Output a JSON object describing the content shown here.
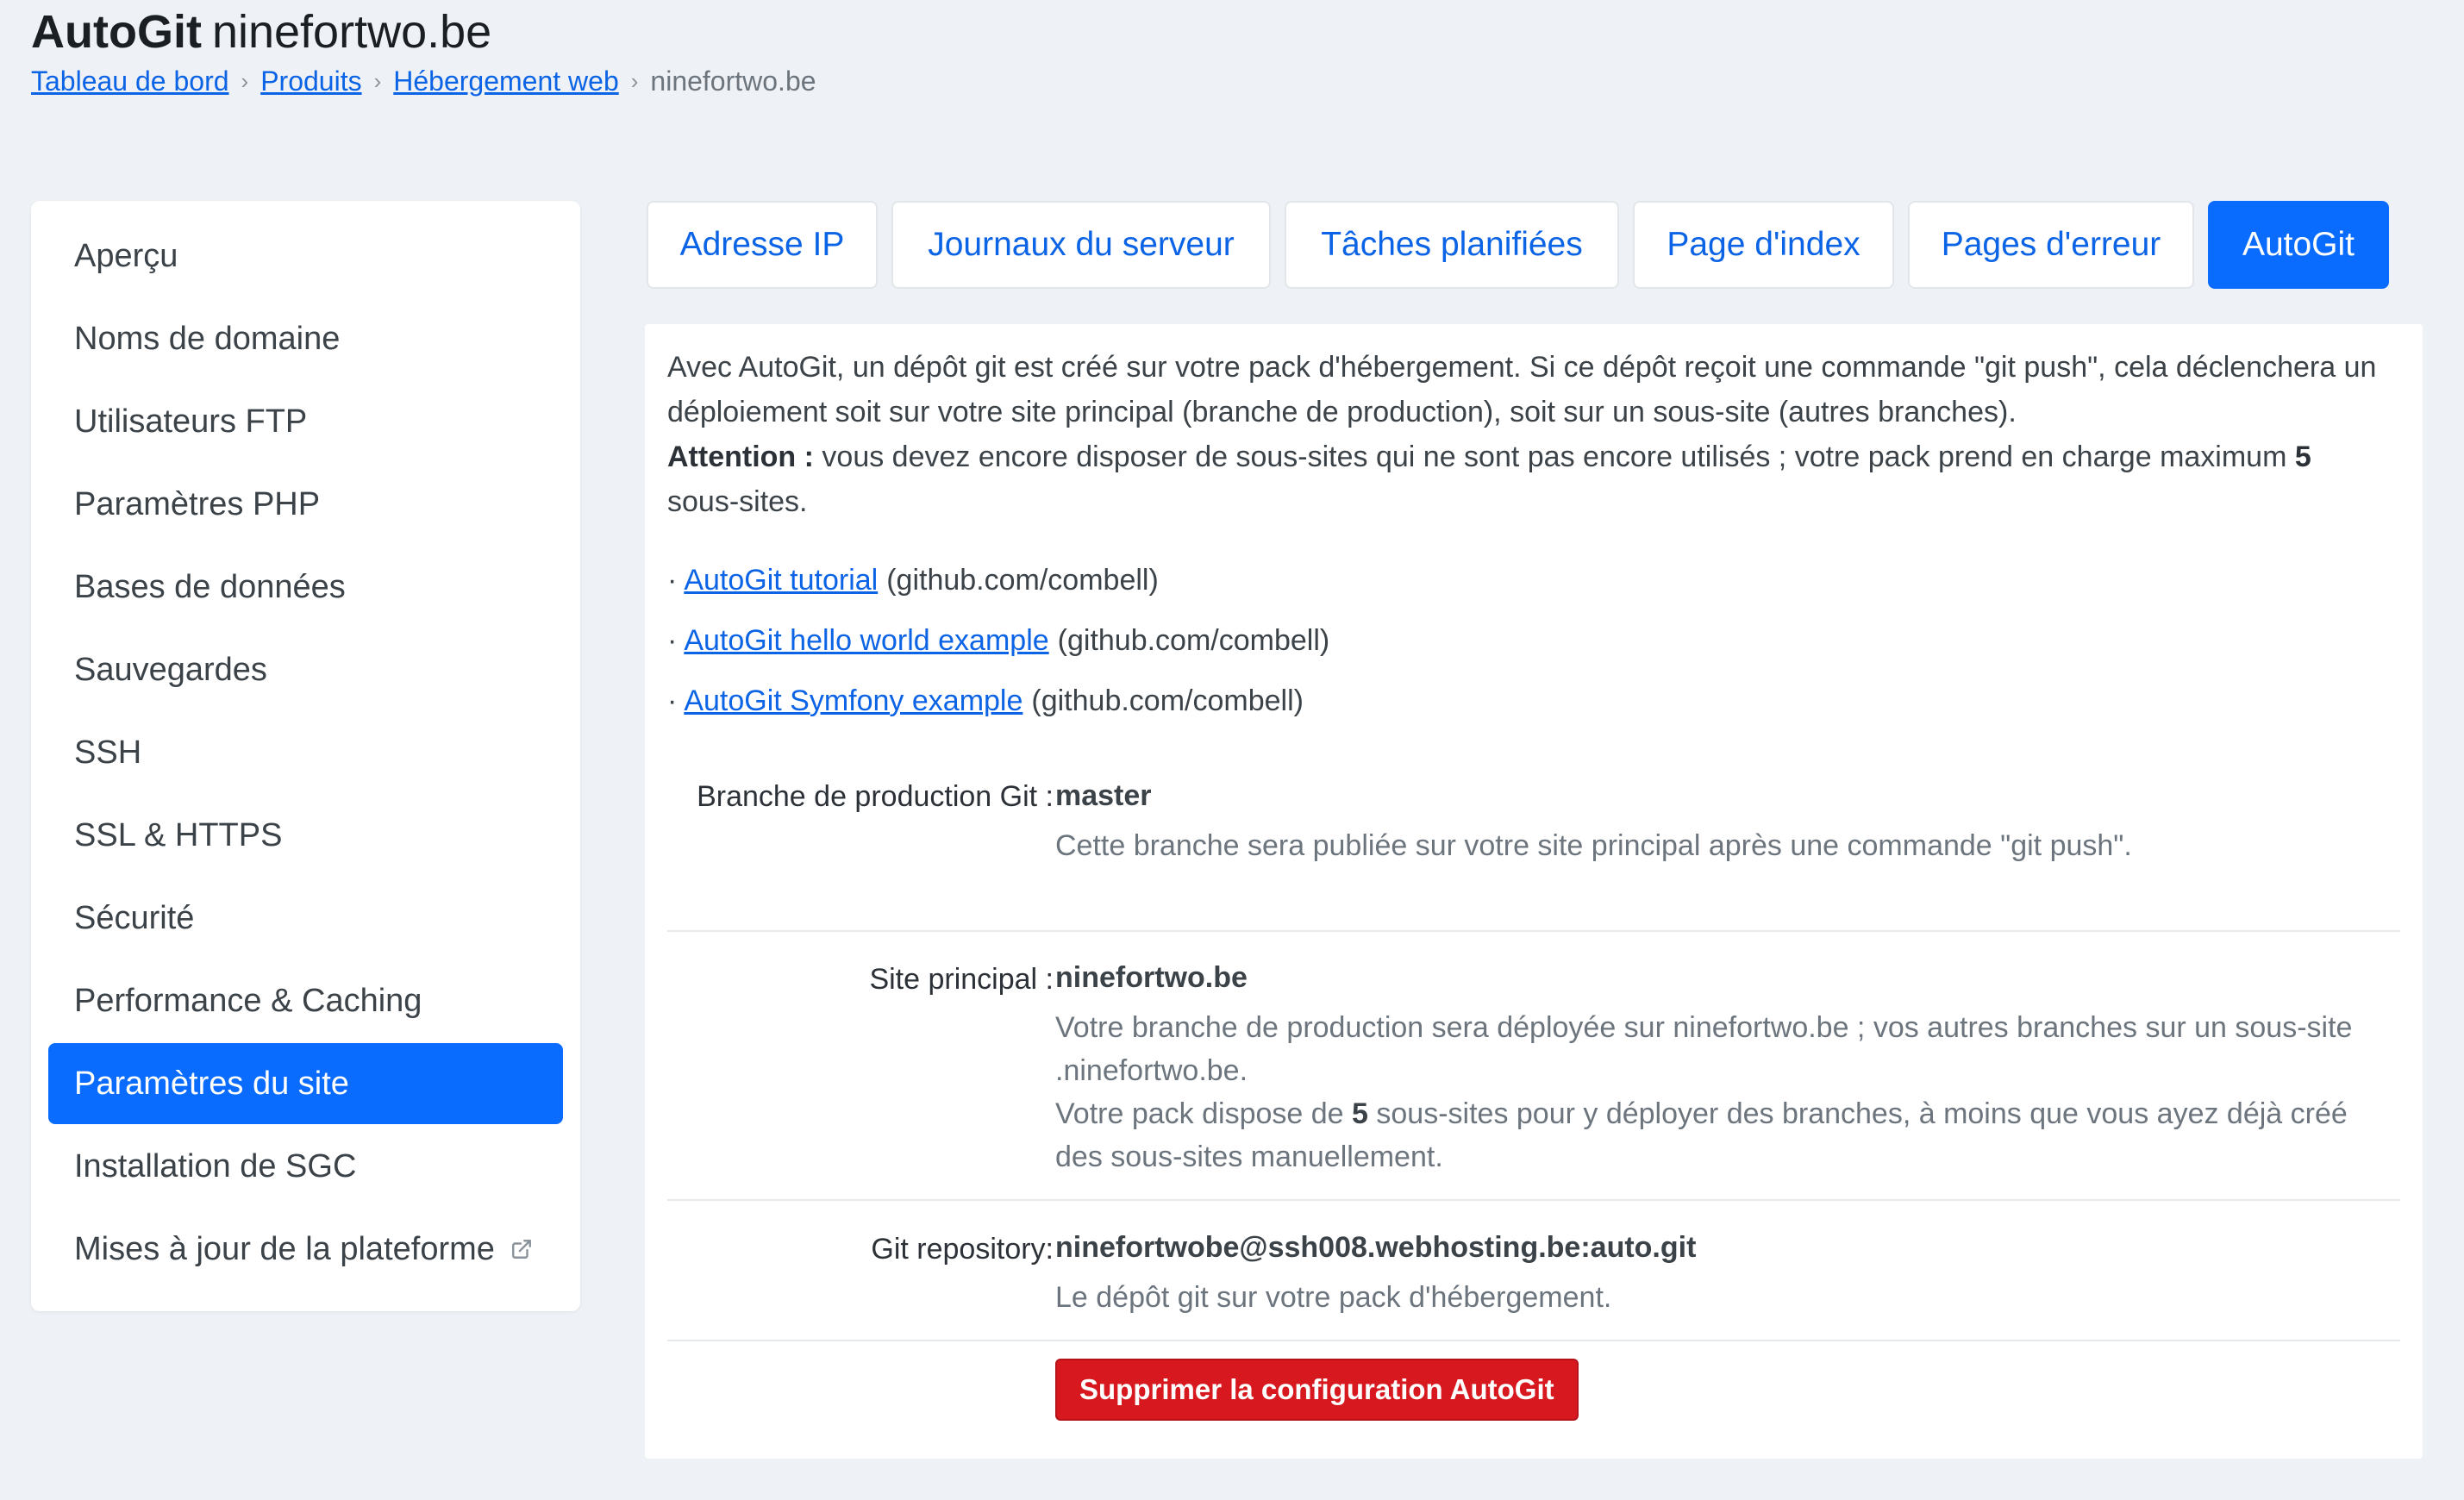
{
  "header": {
    "title_bold": "AutoGit",
    "title_domain": "ninefortwo.be",
    "breadcrumb": [
      "Tableau de bord",
      "Produits",
      "Hébergement web",
      "ninefortwo.be"
    ],
    "breadcrumb_sep": "›"
  },
  "sidebar": {
    "items": [
      {
        "label": "Aperçu"
      },
      {
        "label": "Noms de domaine"
      },
      {
        "label": "Utilisateurs FTP"
      },
      {
        "label": "Paramètres PHP"
      },
      {
        "label": "Bases de données"
      },
      {
        "label": "Sauvegardes"
      },
      {
        "label": "SSH"
      },
      {
        "label": "SSL & HTTPS"
      },
      {
        "label": "Sécurité"
      },
      {
        "label": "Performance & Caching"
      },
      {
        "label": "Paramètres du site",
        "active": true
      },
      {
        "label": "Installation de SGC"
      },
      {
        "label": "Mises à jour de la plateforme",
        "icon": "external-link-icon"
      }
    ]
  },
  "tabs": [
    {
      "label": "Adresse IP"
    },
    {
      "label": "Journaux du serveur"
    },
    {
      "label": "Tâches planifiées"
    },
    {
      "label": "Page d'index"
    },
    {
      "label": "Pages d'erreur"
    },
    {
      "label": "AutoGit",
      "active": true
    }
  ],
  "intro": {
    "text": "Avec AutoGit, un dépôt git est créé sur votre pack d'hébergement. Si ce dépôt reçoit une commande \"git push\", cela déclenchera un déploiement soit sur votre site principal (branche de production), soit sur un sous-site (autres branches).",
    "attention_label": "Attention :",
    "attention_text": "vous devez encore disposer de sous-sites qui ne sont pas encore utilisés ; votre pack prend en charge maximum",
    "attention_count": "5",
    "attention_suffix": "sous-sites."
  },
  "links": {
    "bullet": "·",
    "items": [
      {
        "text": "AutoGit tutorial",
        "source": "(github.com/combell)"
      },
      {
        "text": "AutoGit hello world example",
        "source": "(github.com/combell)"
      },
      {
        "text": "AutoGit Symfony example",
        "source": "(github.com/combell)"
      }
    ]
  },
  "rows": {
    "branch": {
      "label": "Branche de production Git :",
      "value": "master",
      "help": "Cette branche sera publiée sur votre site principal après une commande \"git push\"."
    },
    "site": {
      "label": "Site principal :",
      "value": "ninefortwo.be",
      "help1": "Votre branche de production sera déployée sur ninefortwo.be ; vos autres branches sur un sous-site .ninefortwo.be.",
      "help2_a": "Votre pack dispose de",
      "help2_count": "5",
      "help2_b": "sous-sites pour y déployer des branches, à moins que vous ayez déjà créé des sous-sites manuellement."
    },
    "repo": {
      "label": "Git repository:",
      "value": "ninefortwobe@ssh008.webhosting.be:auto.git",
      "help": "Le dépôt git sur votre pack d'hébergement."
    }
  },
  "actions": {
    "delete_label": "Supprimer la configuration AutoGit"
  },
  "colors": {
    "accent": "#0a6cff",
    "link": "#0b63e5",
    "danger": "#d7191f",
    "background": "#eef1f5"
  }
}
